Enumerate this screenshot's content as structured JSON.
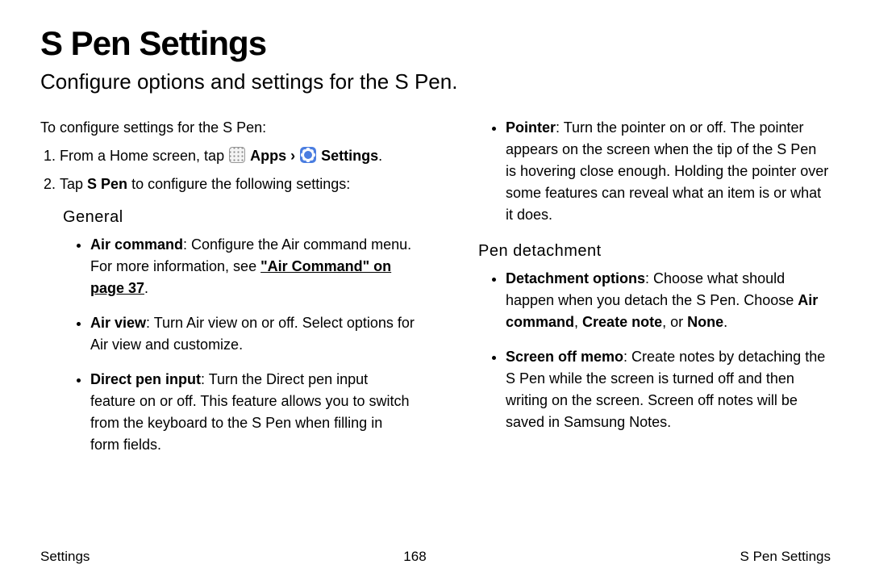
{
  "title": "S Pen Settings",
  "subtitle": "Configure options and settings for the S Pen.",
  "intro": "To configure settings for the S Pen:",
  "step1_pre": "From a Home screen, tap ",
  "step1_apps": "Apps",
  "step1_sep": " › ",
  "step1_settings": "Settings",
  "step1_post": ".",
  "step2_pre": "Tap ",
  "step2_bold": "S Pen",
  "step2_post": " to configure the following settings:",
  "general": {
    "heading": "General",
    "air_command_bold": "Air command",
    "air_command_text": ": Configure the Air command menu. For more information, see ",
    "air_command_link": "\"Air Command\" on page 37",
    "air_command_end": ".",
    "air_view_bold": "Air view",
    "air_view_text": ": Turn Air view on or off. Select options for Air view and customize.",
    "direct_bold": "Direct pen input",
    "direct_text": ": Turn the Direct pen input feature on or off. This feature allows you to switch from the keyboard to the S Pen when filling in form fields."
  },
  "pointer_bold": "Pointer",
  "pointer_text": ": Turn the pointer on or off. The pointer appears on the screen when the tip of the S Pen is hovering close enough. Holding the pointer over some features can reveal what an item is or what it does.",
  "detach": {
    "heading": "Pen detachment",
    "opt_bold": "Detachment options",
    "opt_text1": ": Choose what should happen when you detach the S Pen. Choose ",
    "opt_ac": "Air command",
    "opt_comma": ", ",
    "opt_cn": "Create note",
    "opt_or": ", or ",
    "opt_none": "None",
    "opt_end": ".",
    "memo_bold": "Screen off memo",
    "memo_text": ": Create notes by detaching the S Pen while the screen is turned off and then writing on the screen. Screen off notes will be saved in Samsung Notes."
  },
  "footer": {
    "left": "Settings",
    "center": "168",
    "right": "S Pen Settings"
  }
}
